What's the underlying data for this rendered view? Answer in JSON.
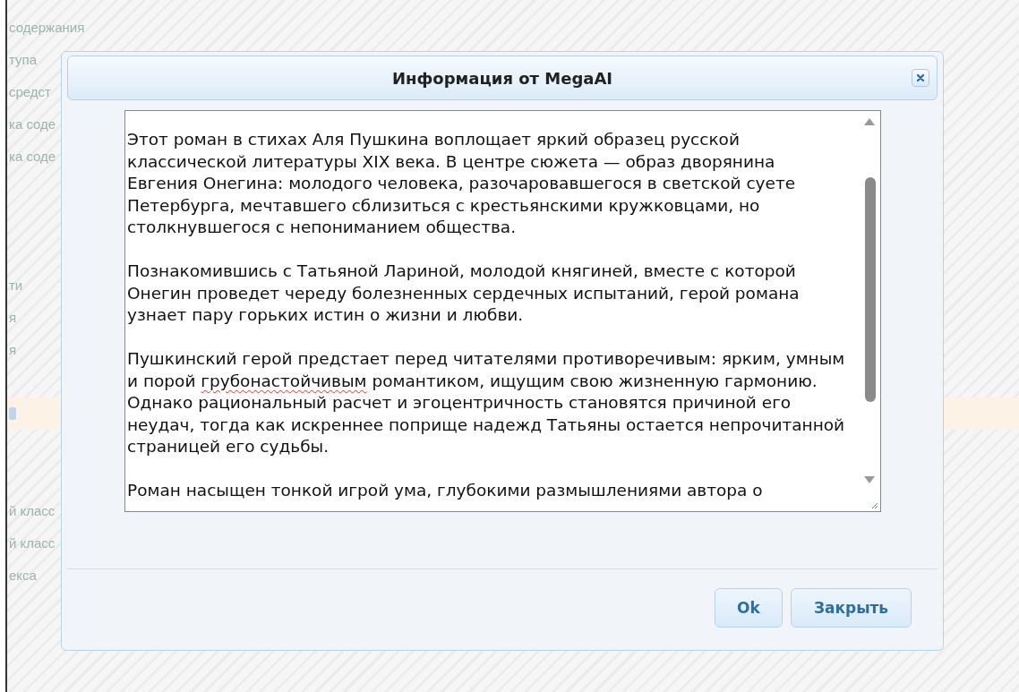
{
  "background_menu": {
    "items": [
      {
        "kind": "text",
        "label": "содержания",
        "selected": false
      },
      {
        "kind": "text",
        "label": "тупа",
        "selected": false
      },
      {
        "kind": "text",
        "label": "средст",
        "selected": false
      },
      {
        "kind": "text",
        "label": "ка соде",
        "selected": false
      },
      {
        "kind": "text",
        "label": "ка соде",
        "selected": false
      },
      {
        "kind": "blank",
        "selected": false
      },
      {
        "kind": "blank",
        "selected": false
      },
      {
        "kind": "blank",
        "selected": false
      },
      {
        "kind": "text",
        "label": "ти",
        "selected": false
      },
      {
        "kind": "text",
        "label": "я",
        "selected": false
      },
      {
        "kind": "text",
        "label": "я",
        "selected": false
      },
      {
        "kind": "blank",
        "selected": false
      },
      {
        "kind": "icon",
        "selected": true
      },
      {
        "kind": "blank",
        "selected": false
      },
      {
        "kind": "blank",
        "selected": false
      },
      {
        "kind": "text",
        "label": "й класс",
        "selected": false
      },
      {
        "kind": "text",
        "label": "й класс",
        "selected": false
      },
      {
        "kind": "text",
        "label": "екса",
        "selected": false
      }
    ]
  },
  "dialog": {
    "title": "Информация от MegaAI",
    "paragraphs": [
      {
        "lines": [
          [
            {
              "text": "Этот роман в стихах Аля Пушкина воплощает яркий образец русской",
              "misspelled": false
            }
          ],
          [
            {
              "text": "классической литературы XIX века. В центре сюжета — образ дворянина",
              "misspelled": false
            }
          ],
          [
            {
              "text": "Евгения Онегина: молодого человека, разочаровавшегося в светской суете",
              "misspelled": false
            }
          ],
          [
            {
              "text": "Петербурга, мечтавшего сблизиться с крестьянскими кружковцами, но",
              "misspelled": false
            }
          ],
          [
            {
              "text": "столкнувшегося с непониманием общества.",
              "misspelled": false
            }
          ]
        ]
      },
      {
        "lines": [
          [
            {
              "text": "Познакомившись с Татьяной Лариной, молодой княгиней, вместе с которой",
              "misspelled": false
            }
          ],
          [
            {
              "text": "Онегин проведет череду болезненных сердечных испытаний, герой романа",
              "misspelled": false
            }
          ],
          [
            {
              "text": "узнает пару горьких истин о жизни и любви.",
              "misspelled": false
            }
          ]
        ]
      },
      {
        "lines": [
          [
            {
              "text": "Пушкинский герой предстает перед читателями противоречивым: ярким, умным",
              "misspelled": false
            }
          ],
          [
            {
              "text": "и порой ",
              "misspelled": false
            },
            {
              "text": "грубонастойчивым",
              "misspelled": true
            },
            {
              "text": " романтиком, ищущим свою жизненную гармонию.",
              "misspelled": false
            }
          ],
          [
            {
              "text": "Однако рациональный расчет и эгоцентричность становятся причиной его",
              "misspelled": false
            }
          ],
          [
            {
              "text": "неудач, тогда как искреннее поприще надежд Татьяны остается непрочитанной",
              "misspelled": false
            }
          ],
          [
            {
              "text": "страницей его судьбы.",
              "misspelled": false
            }
          ]
        ]
      },
      {
        "lines": [
          [
            {
              "text": "Роман насыщен тонкой игрой ума, глубокими размышлениями автора о",
              "misspelled": false
            }
          ]
        ]
      }
    ],
    "buttons": [
      "Ok",
      "Закрыть"
    ]
  }
}
